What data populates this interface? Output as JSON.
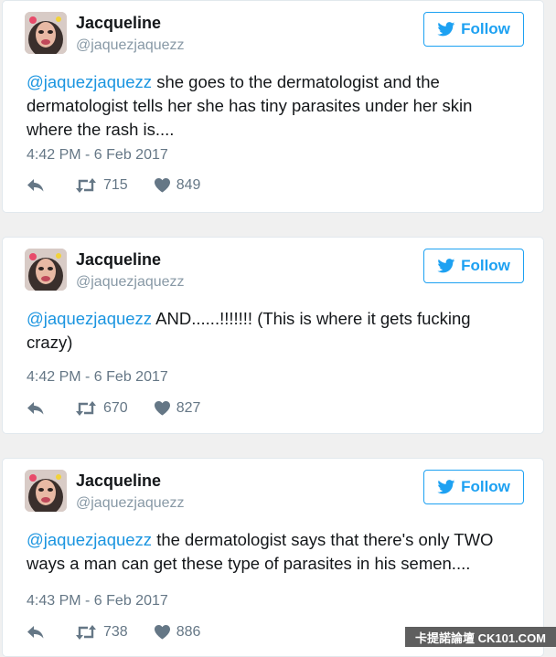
{
  "colors": {
    "link": "#1b95e0",
    "brand_blue": "#1da1f2",
    "meta_gray": "#657786",
    "card_border": "#e1e8ed"
  },
  "icons": {
    "reply": "reply-arrow-icon",
    "retweet": "retweet-icon",
    "like": "heart-icon",
    "follow": "twitter-bird-icon"
  },
  "tweets": [
    {
      "name": "Jacqueline",
      "handle": "@jaquezjaquezz",
      "follow_label": "Follow",
      "mention": "@jaquezjaquezz",
      "body": " she goes to the dermatologist and the dermatologist tells her she has tiny parasites under her skin where the rash is....",
      "timestamp": "4:42 PM - 6 Feb 2017",
      "retweets": "715",
      "likes": "849"
    },
    {
      "name": "Jacqueline",
      "handle": "@jaquezjaquezz",
      "follow_label": "Follow",
      "mention": "@jaquezjaquezz",
      "body": " AND......!!!!!!! (This is where it gets fucking crazy)",
      "timestamp": "4:42 PM - 6 Feb 2017",
      "retweets": "670",
      "likes": "827"
    },
    {
      "name": "Jacqueline",
      "handle": "@jaquezjaquezz",
      "follow_label": "Follow",
      "mention": "@jaquezjaquezz",
      "body": " the dermatologist says that there's only TWO ways a man can get these type of parasites in his semen....",
      "timestamp": "4:43 PM - 6 Feb 2017",
      "retweets": "738",
      "likes": "886"
    }
  ],
  "watermark": "卡提諾論壇 CK101.COM"
}
